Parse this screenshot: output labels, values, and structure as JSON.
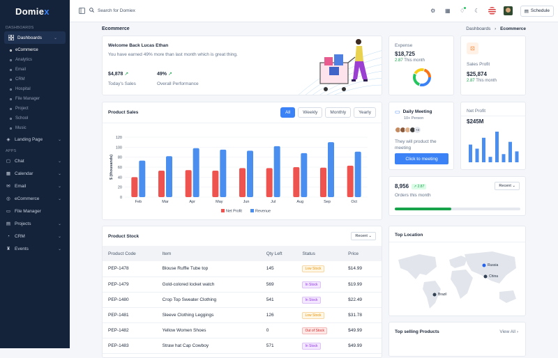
{
  "brand": {
    "name": "Domie",
    "accent": "x"
  },
  "sidebar": {
    "section_dashboards": "DASHBOARDS",
    "dashboards_label": "Dashboards",
    "dash_items": [
      {
        "label": "eCommerce",
        "active": true
      },
      {
        "label": "Analytics"
      },
      {
        "label": "Email"
      },
      {
        "label": "CRM"
      },
      {
        "label": "Hospital"
      },
      {
        "label": "File Manager"
      },
      {
        "label": "Project"
      },
      {
        "label": "School"
      },
      {
        "label": "Music"
      }
    ],
    "landing": "Landing Page",
    "section_apps": "APPS",
    "apps": [
      "Chat",
      "Calendar",
      "Email",
      "eCommerce",
      "File Manager",
      "Projects",
      "CRM",
      "Events"
    ]
  },
  "topbar": {
    "search_placeholder": "Search for Domiex",
    "schedule": "Schedule"
  },
  "breadcrumb": {
    "title": "Ecommerce",
    "parent": "Dashboards",
    "current": "Ecommerce"
  },
  "welcome": {
    "title": "Welcome Back Lucas Ethan",
    "subtitle": "You have earned 49% more than last month which is great thing.",
    "sales_value": "$4,878",
    "sales_label": "Today's Sales",
    "perf_value": "49%",
    "perf_label": "Overall Performance"
  },
  "expense": {
    "label": "Expense",
    "value": "$18,725",
    "change": "2.87",
    "note": "This month"
  },
  "sales_profit": {
    "label": "Sales Profit",
    "value": "$25,874",
    "change": "2.87",
    "note": "This month"
  },
  "product_sales": {
    "title": "Product Sales",
    "tabs": [
      "All",
      "Weekly",
      "Monthly",
      "Yearly"
    ]
  },
  "chart_data": {
    "type": "bar",
    "categories": [
      "Feb",
      "Mar",
      "Apr",
      "May",
      "Jun",
      "Jul",
      "Aug",
      "Sep",
      "Oct"
    ],
    "ylabel": "$ (thousands)",
    "ylim": [
      0,
      120
    ],
    "yticks": [
      0,
      20,
      40,
      60,
      80,
      100,
      120
    ],
    "series": [
      {
        "name": "Net Profit",
        "color": "#ef5350",
        "values": [
          40,
          53,
          54,
          53,
          58,
          58,
          60,
          59,
          63
        ]
      },
      {
        "name": "Revenue",
        "color": "#4a8ff0",
        "values": [
          73,
          82,
          98,
          95,
          93,
          102,
          88,
          110,
          91
        ]
      }
    ],
    "legend": "bottom"
  },
  "meeting": {
    "title": "Daily Meeting",
    "count": "10+ Person",
    "more": "+4",
    "text": "They will product the meeting",
    "button": "Click to meeting"
  },
  "net_profit": {
    "label": "Net Profit",
    "value": "$245M",
    "values": [
      26,
      20,
      36,
      8,
      45,
      12,
      30,
      16
    ]
  },
  "orders": {
    "value": "8,956",
    "change": "2.87",
    "label": "Orders this month",
    "dropdown": "Recent",
    "progress": 0.45
  },
  "stock": {
    "title": "Product Stock",
    "dropdown": "Recent",
    "columns": [
      "Product Code",
      "Item",
      "Qty Left",
      "Status",
      "Price"
    ],
    "rows": [
      {
        "code": "PEP-1478",
        "item": "Blouse Ruffle Tube top",
        "qty": "145",
        "status": "Low Stock",
        "price": "$14.99"
      },
      {
        "code": "PEP-1479",
        "item": "Gold-colored locket watch",
        "qty": "569",
        "status": "In Stock",
        "price": "$19.99"
      },
      {
        "code": "PEP-1480",
        "item": "Crop Top Sweater Clothing",
        "qty": "541",
        "status": "In Stock",
        "price": "$22.49"
      },
      {
        "code": "PEP-1481",
        "item": "Sleeve Clothing Leggings",
        "qty": "126",
        "status": "Low Stock",
        "price": "$31.78"
      },
      {
        "code": "PEP-1482",
        "item": "Yellow Women Shoes",
        "qty": "0",
        "status": "Out of Stock",
        "price": "$49.99"
      },
      {
        "code": "PEP-1483",
        "item": "Straw hat Cap Cowboy",
        "qty": "571",
        "status": "In Stock",
        "price": "$49.99"
      }
    ]
  },
  "location": {
    "title": "Top Location",
    "markers": [
      "Russia",
      "China",
      "Brazil"
    ]
  },
  "top_selling": {
    "title": "Top selling Products",
    "link": "View All"
  }
}
